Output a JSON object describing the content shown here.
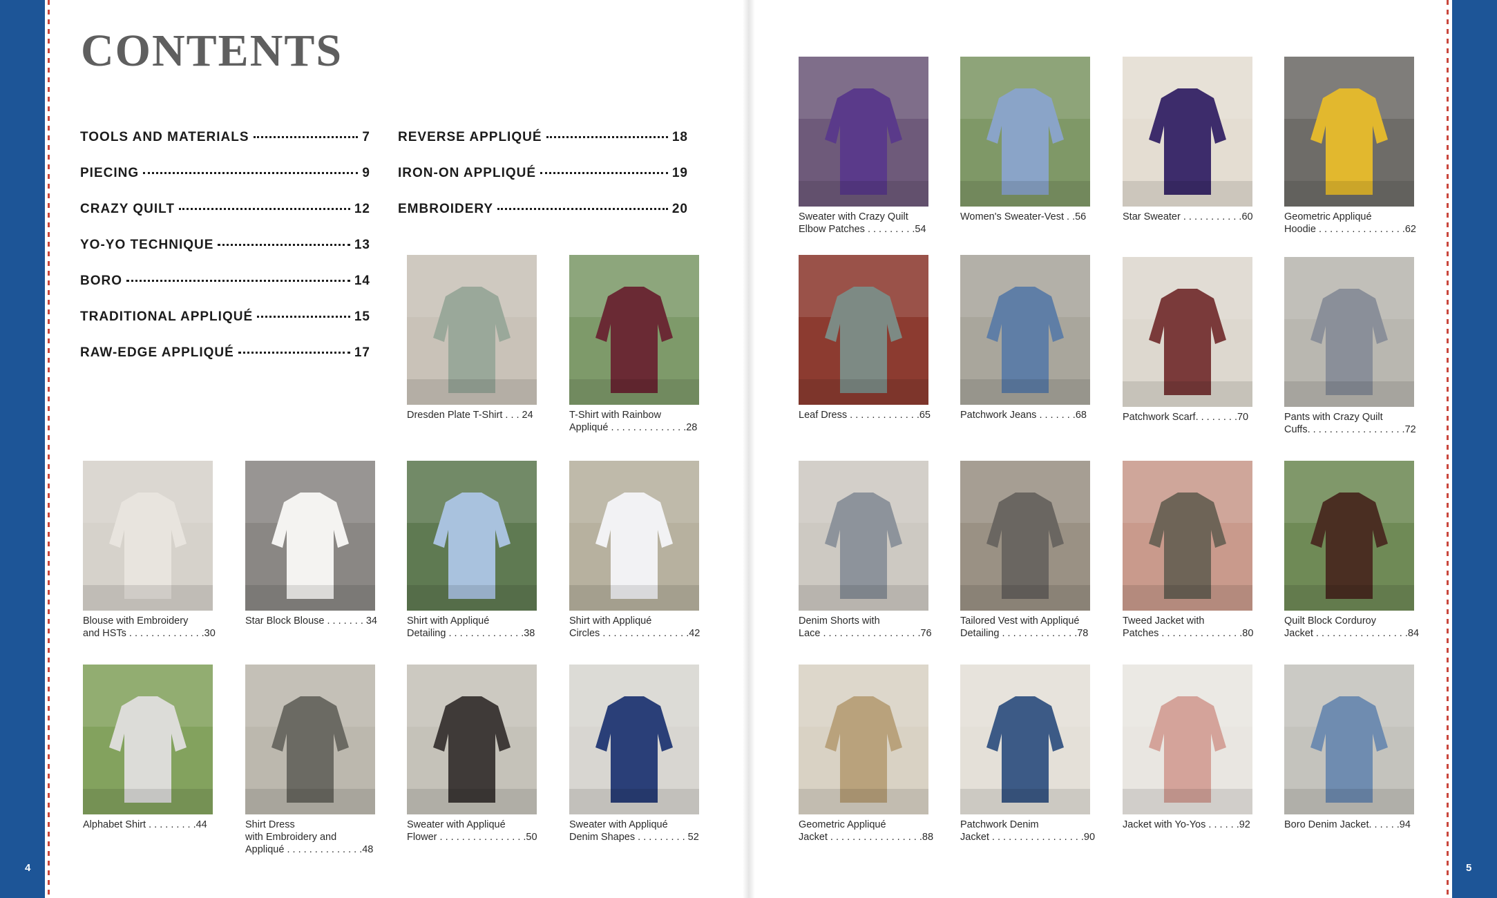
{
  "left_page_number": "4",
  "right_page_number": "5",
  "title": "CONTENTS",
  "toc": [
    {
      "label": "TOOLS AND MATERIALS",
      "page": "7"
    },
    {
      "label": "PIECING",
      "page": "9"
    },
    {
      "label": "CRAZY QUILT",
      "page": "12"
    },
    {
      "label": "YO-YO TECHNIQUE",
      "page": "13"
    },
    {
      "label": "BORO",
      "page": "14"
    },
    {
      "label": "TRADITIONAL APPLIQUÉ",
      "page": "15"
    },
    {
      "label": "RAW-EDGE APPLIQUÉ",
      "page": "17"
    },
    {
      "label": "REVERSE APPLIQUÉ",
      "page": "18"
    },
    {
      "label": "IRON-ON APPLIQUÉ",
      "page": "19"
    },
    {
      "label": "EMBROIDERY",
      "page": "20"
    }
  ],
  "projects": [
    {
      "line1": "Dresden Plate T-Shirt . . . 24",
      "line2": "",
      "line3": "",
      "bg": "#c9c2b8",
      "fg": "#9aa89a"
    },
    {
      "line1": "T-Shirt with Rainbow",
      "line2": "Appliqué . . . . . . . . . . . . . .28",
      "line3": "",
      "bg": "#7e9a6a",
      "fg": "#6a2a34"
    },
    {
      "line1": "Blouse with Embroidery",
      "line2": "and HSTs . . . . . . . . . . . . . .30",
      "line3": "",
      "bg": "#d6d2cb",
      "fg": "#e8e4de"
    },
    {
      "line1": "Star Block Blouse . . . . . . . 34",
      "line2": "",
      "line3": "",
      "bg": "#8a8784",
      "fg": "#f4f3f1"
    },
    {
      "line1": "Shirt with Appliqué",
      "line2": "Detailing . . . . . . . . . . . . . .38",
      "line3": "",
      "bg": "#5f7a52",
      "fg": "#a9c2de"
    },
    {
      "line1": "Shirt with Appliqué",
      "line2": "Circles . . . . . . . . . . . . . . . .42",
      "line3": "",
      "bg": "#b7b19f",
      "fg": "#f2f2f4"
    },
    {
      "line1": "Alphabet Shirt . . . . . . . . .44",
      "line2": "",
      "line3": "",
      "bg": "#83a25e",
      "fg": "#dcdcd8"
    },
    {
      "line1": "Shirt Dress",
      "line2": "with Embroidery and",
      "line3": "Appliqué . . . . . . . . . . . . . .48",
      "bg": "#bcb8ae",
      "fg": "#6b6a63"
    },
    {
      "line1": "Sweater with Appliqué",
      "line2": "Flower . . . . . . . . . . . . . . . .50",
      "line3": "",
      "bg": "#c5c2b9",
      "fg": "#3f3a38"
    },
    {
      "line1": "Sweater with Appliqué",
      "line2": "Denim Shapes . . . . . . . . . 52",
      "line3": "",
      "bg": "#d8d6d1",
      "fg": "#2a3f78"
    },
    {
      "line1": "Sweater with Crazy Quilt",
      "line2": "Elbow Patches . . . . . . . . .54",
      "line3": "",
      "bg": "#6e5a7a",
      "fg": "#5a3a8a"
    },
    {
      "line1": "Women's Sweater-Vest . .56",
      "line2": "",
      "line3": "",
      "bg": "#7f9867",
      "fg": "#8aa4c8"
    },
    {
      "line1": "Star Sweater . . . . . . . . . . .60",
      "line2": "",
      "line3": "",
      "bg": "#e4ddd2",
      "fg": "#3d2c6b"
    },
    {
      "line1": "Geometric Appliqué",
      "line2": "Hoodie . . . . . . . . . . . . . . . .62",
      "line3": "",
      "bg": "#6e6c68",
      "fg": "#e2b82e"
    },
    {
      "line1": "Leaf Dress . . . . . . . . . . . . .65",
      "line2": "",
      "line3": "",
      "bg": "#8c3b30",
      "fg": "#7d8a84"
    },
    {
      "line1": "Patchwork Jeans . . . . . . .68",
      "line2": "",
      "line3": "",
      "bg": "#a9a69c",
      "fg": "#5f7ea6"
    },
    {
      "line1": "Patchwork Scarf. . . . . . . .70",
      "line2": "",
      "line3": "",
      "bg": "#ddd8cf",
      "fg": "#7a3a3a"
    },
    {
      "line1": "Pants with Crazy Quilt",
      "line2": "Cuffs. . . . . . . . . . . . . . . . . .72",
      "line3": "",
      "bg": "#b9b7b0",
      "fg": "#8a8f99"
    },
    {
      "line1": "Denim Shorts with",
      "line2": "Lace . . . . . . . . . . . . . . . . . .76",
      "line3": "",
      "bg": "#cdc9c2",
      "fg": "#8d939b"
    },
    {
      "line1": "Tailored Vest with Appliqué",
      "line2": "Detailing . . . . . . . . . . . . . .78",
      "line3": "",
      "bg": "#9a9184",
      "fg": "#6a6661"
    },
    {
      "line1": "Tweed Jacket with",
      "line2": "Patches . . . . . . . . . . . . . . .80",
      "line3": "",
      "bg": "#c99a8c",
      "fg": "#6e6457"
    },
    {
      "line1": "Quilt Block Corduroy",
      "line2": "Jacket . . . . . . . . . . . . . . . . .84",
      "line3": "",
      "bg": "#6f8a56",
      "fg": "#4a2e22"
    },
    {
      "line1": "Geometric Appliqué",
      "line2": "Jacket . . . . . . . . . . . . . . . . .88",
      "line3": "",
      "bg": "#d9d2c4",
      "fg": "#b9a27c"
    },
    {
      "line1": "Patchwork Denim",
      "line2": "Jacket . . . . . . . . . . . . . . . . .90",
      "line3": "",
      "bg": "#e4e0d8",
      "fg": "#3c5a86"
    },
    {
      "line1": "Jacket with Yo-Yos . . . . . .92",
      "line2": "",
      "line3": "",
      "bg": "#e9e6e1",
      "fg": "#d4a39a"
    },
    {
      "line1": "Boro Denim Jacket. . . . . .94",
      "line2": "",
      "line3": "",
      "bg": "#c4c3bd",
      "fg": "#6f8cb0"
    }
  ]
}
